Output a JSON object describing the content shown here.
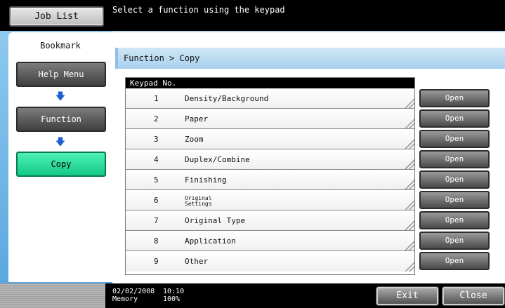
{
  "header": {
    "job_list_label": "Job List",
    "message": "Select a function using the keypad"
  },
  "sidebar": {
    "title": "Bookmark",
    "items": [
      {
        "label": "Help Menu"
      },
      {
        "label": "Function"
      },
      {
        "label": "Copy"
      }
    ]
  },
  "main": {
    "breadcrumb": "Function > Copy",
    "table_header": "Keypad No.",
    "rows": [
      {
        "num": "1",
        "label": "Density/Background"
      },
      {
        "num": "2",
        "label": "Paper"
      },
      {
        "num": "3",
        "label": "Zoom"
      },
      {
        "num": "4",
        "label": "Duplex/Combine"
      },
      {
        "num": "5",
        "label": "Finishing"
      },
      {
        "num": "6",
        "label_line1": "Original",
        "label_line2": "Settings"
      },
      {
        "num": "7",
        "label": "Original Type"
      },
      {
        "num": "8",
        "label": "Application"
      },
      {
        "num": "9",
        "label": "Other"
      }
    ],
    "open_label": "Open"
  },
  "footer": {
    "date": "02/02/2008",
    "time": "10:10",
    "memory_label": "Memory",
    "memory_value": "100%",
    "exit_label": "Exit",
    "close_label": "Close"
  },
  "colors": {
    "accent_blue": "#5aa8df",
    "active_green": "#13c987",
    "arrow_blue": "#1e5fd0"
  }
}
